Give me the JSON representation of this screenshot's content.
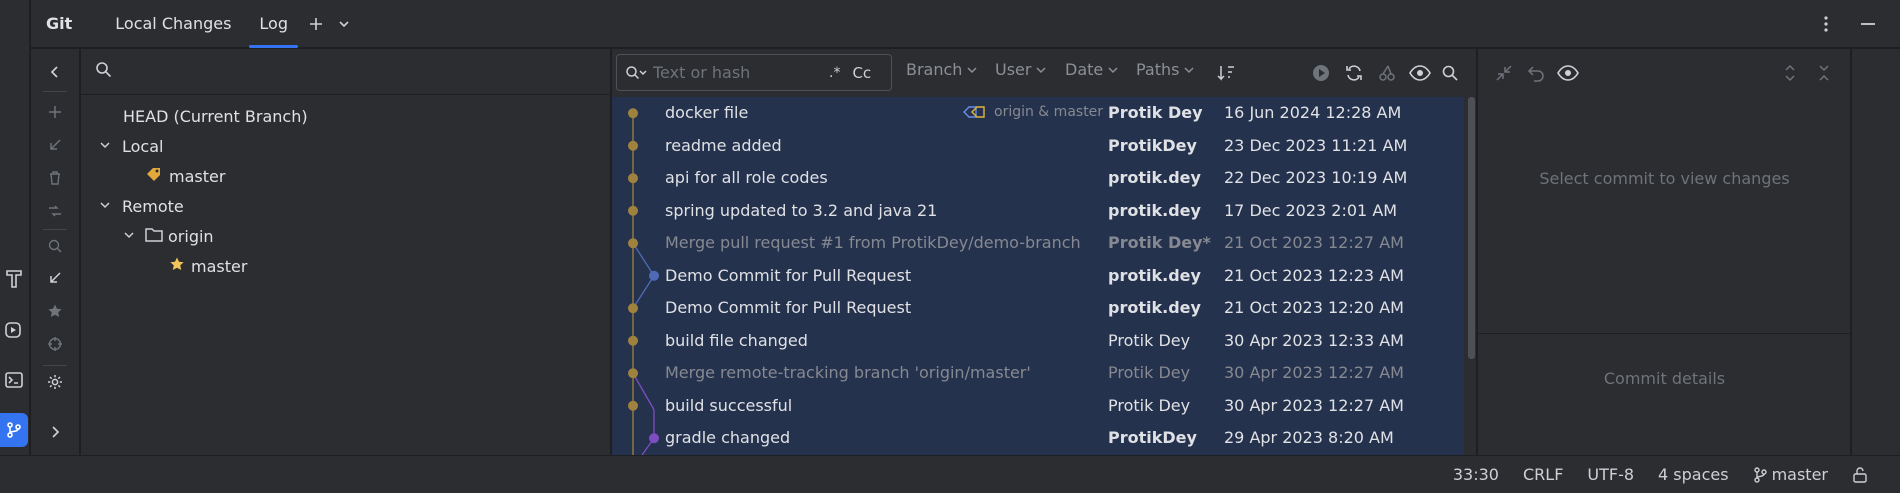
{
  "header": {
    "title": "Git",
    "tabs": [
      {
        "label": "Local Changes"
      },
      {
        "label": "Log"
      }
    ]
  },
  "branches": {
    "head": "HEAD (Current Branch)",
    "local_label": "Local",
    "local_branch": "master",
    "remote_label": "Remote",
    "remote_origin": "origin",
    "remote_branch": "master"
  },
  "log_toolbar": {
    "search_placeholder": "Text or hash",
    "regex_label": ".*",
    "case_label": "Cc",
    "filters": [
      "Branch",
      "User",
      "Date",
      "Paths"
    ]
  },
  "commits": [
    {
      "message": "docker file",
      "refs": "origin & master",
      "author": "Protik Dey",
      "date": "16 Jun 2024 12:28 AM",
      "style": "bold"
    },
    {
      "message": "readme added",
      "author": "ProtikDey",
      "date": "23 Dec 2023 11:21 AM",
      "style": "bold"
    },
    {
      "message": "api for all role codes",
      "author": "protik.dey",
      "date": "22 Dec 2023 10:19 AM",
      "style": "bold"
    },
    {
      "message": "spring updated to 3.2 and java 21",
      "author": "protik.dey",
      "date": "17 Dec 2023 2:01 AM",
      "style": "bold"
    },
    {
      "message": "Merge pull request #1 from ProtikDey/demo-branch",
      "author": "Protik Dey*",
      "date": "21 Oct 2023 12:27 AM",
      "style": "dim-bold"
    },
    {
      "message": "Demo Commit for Pull Request",
      "author": "protik.dey",
      "date": "21 Oct 2023 12:23 AM",
      "style": "bold"
    },
    {
      "message": "Demo Commit for Pull Request",
      "author": "protik.dey",
      "date": "21 Oct 2023 12:20 AM",
      "style": "bold"
    },
    {
      "message": "build file changed",
      "author": "Protik Dey",
      "date": "30 Apr 2023 12:33 AM",
      "style": "normal"
    },
    {
      "message": "Merge remote-tracking branch 'origin/master'",
      "author": "Protik Dey",
      "date": "30 Apr 2023 12:27 AM",
      "style": "dim"
    },
    {
      "message": "build successful",
      "author": "Protik Dey",
      "date": "30 Apr 2023 12:27 AM",
      "style": "normal"
    },
    {
      "message": "gradle changed",
      "author": "ProtikDey",
      "date": "29 Apr 2023 8:20 AM",
      "style": "bold"
    }
  ],
  "changes": {
    "empty_text": "Select commit to view changes",
    "details_text": "Commit details"
  },
  "status_bar": {
    "position": "33:30",
    "line_ending": "CRLF",
    "encoding": "UTF-8",
    "indent": "4 spaces",
    "branch": "master"
  },
  "colors": {
    "accent": "#3574f0",
    "graph_main": "#a0823f",
    "graph_blue": "#4f6bb8",
    "graph_purple": "#7d4ec2",
    "selection": "#25324d"
  }
}
